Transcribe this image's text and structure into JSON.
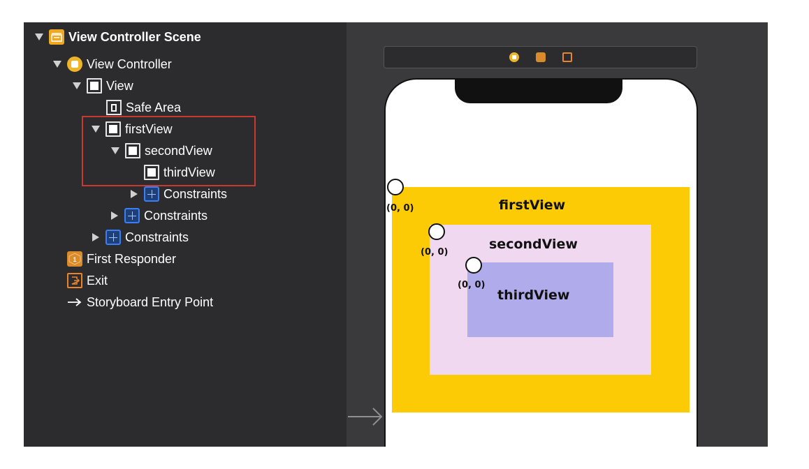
{
  "outline": {
    "items": [
      {
        "label": "View Controller Scene",
        "icon": "scene-icon",
        "expanded": true
      },
      {
        "label": "View Controller",
        "icon": "view-controller-icon",
        "expanded": true
      },
      {
        "label": "View",
        "icon": "view-icon",
        "expanded": true
      },
      {
        "label": "Safe Area",
        "icon": "safe-area-icon"
      },
      {
        "label": "firstView",
        "icon": "view-icon",
        "expanded": true
      },
      {
        "label": "secondView",
        "icon": "view-icon",
        "expanded": true
      },
      {
        "label": "thirdView",
        "icon": "view-icon"
      },
      {
        "label": "Constraints",
        "icon": "constraints-icon",
        "expanded": false
      },
      {
        "label": "Constraints",
        "icon": "constraints-icon",
        "expanded": false
      },
      {
        "label": "Constraints",
        "icon": "constraints-icon",
        "expanded": false
      },
      {
        "label": "First Responder",
        "icon": "first-responder-icon"
      },
      {
        "label": "Exit",
        "icon": "exit-icon"
      },
      {
        "label": "Storyboard Entry Point",
        "icon": "arrow-icon"
      }
    ],
    "highlight_color": "#c9392f"
  },
  "canvas": {
    "toolbar_icons": [
      "view-controller-icon",
      "first-responder-icon",
      "exit-icon"
    ],
    "views": [
      {
        "name": "firstView",
        "color": "#fccb06",
        "origin": "(0, 0)"
      },
      {
        "name": "secondView",
        "color": "#f0d8f0",
        "origin": "(0, 0)"
      },
      {
        "name": "thirdView",
        "color": "#b0aceb",
        "origin": "(0, 0)"
      }
    ]
  }
}
